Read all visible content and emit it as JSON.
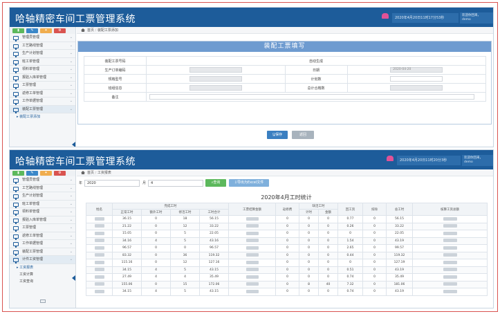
{
  "app_title": "哈轴精密车间工票管理系统",
  "top": {
    "datetime": "2020年4月20日11时17分53秒",
    "datetime2": "2020年4月20日11时20分3秒",
    "user_line1": "欢迎你回来，",
    "user_line2": "demo"
  },
  "toolbar_icons": [
    {
      "icon": "chart-icon",
      "glyph": "▮",
      "color": "#5cb85c"
    },
    {
      "icon": "pencil-icon",
      "glyph": "✎",
      "color": "#3a87c8"
    },
    {
      "icon": "users-icon",
      "glyph": "✦",
      "color": "#f0ad4e"
    },
    {
      "icon": "gear-icon",
      "glyph": "⚙",
      "color": "#d9534f"
    }
  ],
  "menu1": [
    "管理员管理",
    "工艺路线管理",
    "生产计划管理",
    "班工单管理",
    "领料单管理",
    "报验入库单管理",
    "工票管理",
    "返修工单管理",
    "工作单据管理",
    "装配工票管理"
  ],
  "menu1_sub": "装配工票添加",
  "menu2": [
    "管理员管理",
    "工艺路线管理",
    "生产计划管理",
    "班工单管理",
    "领料单管理",
    "报验入库单管理",
    "工票管理",
    "返修工单管理",
    "工作单据管理",
    "装配工票管理",
    "计件工资管理"
  ],
  "menu2_subs": [
    "工资报表",
    "工资计算",
    "工资查询"
  ],
  "crumb1": {
    "home": "首页",
    "page": "装配工票添加"
  },
  "crumb2": {
    "home": "首页",
    "page": "工资报表"
  },
  "form": {
    "title": "装配工票填写",
    "r1": {
      "l1": "装配工票号码",
      "v1": "自动生成"
    },
    "r2": {
      "l1": "生产订单编码",
      "l2": "日期",
      "date": "2020-04-20"
    },
    "r3": {
      "l1": "规格型号",
      "l2": "计划数"
    },
    "r4": {
      "l1": "班组信息",
      "l2": "总计合格数"
    },
    "r5": {
      "l1": "备注"
    },
    "save": "保存",
    "back": "返回"
  },
  "report": {
    "year_label": "年",
    "year": "2020",
    "month_label": "月",
    "month": "4",
    "query": "查询",
    "export": "导出为Excel文件",
    "title": "2020年4月工时统计",
    "h_name": "姓名",
    "h_finish": "完成工时",
    "h_finish_sub": [
      "正常工时",
      "额外工时",
      "修活工时",
      "工时合计"
    ],
    "h_amount": "工票结算金额",
    "h_repair": "返修费",
    "h_shortage": "缺活工时",
    "h_shortage_sub": [
      "计时",
      "金额"
    ],
    "h_backpay": "回工资",
    "h_deduct": "扣除",
    "h_total": "总工时",
    "h_sum": "核算工资总额",
    "rows": [
      [
        "36.15",
        "0",
        "18",
        "56.15",
        "0",
        "0",
        "0",
        "0.77",
        "0",
        "56.15"
      ],
      [
        "21.22",
        "0",
        "12",
        "33.22",
        "0",
        "0",
        "0",
        "0.26",
        "0",
        "33.22"
      ],
      [
        "15.05",
        "0",
        "5",
        "22.05",
        "0",
        "0",
        "0",
        "0",
        "0",
        "22.05"
      ],
      [
        "34.16",
        "4",
        "5",
        "43.16",
        "0",
        "0",
        "0",
        "1.54",
        "0",
        "43.19"
      ],
      [
        "96.57",
        "0",
        "0",
        "96.57",
        "0",
        "0",
        "0",
        "2.65",
        "0",
        "99.57"
      ],
      [
        "83.32",
        "0",
        "36",
        "119.32",
        "0",
        "0",
        "0",
        "0.44",
        "0",
        "119.32"
      ],
      [
        "115.16",
        "0",
        "12",
        "127.16",
        "0",
        "0",
        "0",
        "0",
        "0",
        "127.19"
      ],
      [
        "34.15",
        "4",
        "5",
        "43.15",
        "0",
        "0",
        "0",
        "0.51",
        "0",
        "43.19"
      ],
      [
        "27.49",
        "4",
        "4",
        "35.49",
        "0",
        "0",
        "0",
        "0.74",
        "0",
        "35.49"
      ],
      [
        "155.06",
        "0",
        "15",
        "172.06",
        "0",
        "8",
        "40",
        "7.32",
        "0",
        "181.06"
      ],
      [
        "34.15",
        "4",
        "5",
        "43.15",
        "0",
        "0",
        "0",
        "0.74",
        "0",
        "43.19"
      ]
    ]
  }
}
